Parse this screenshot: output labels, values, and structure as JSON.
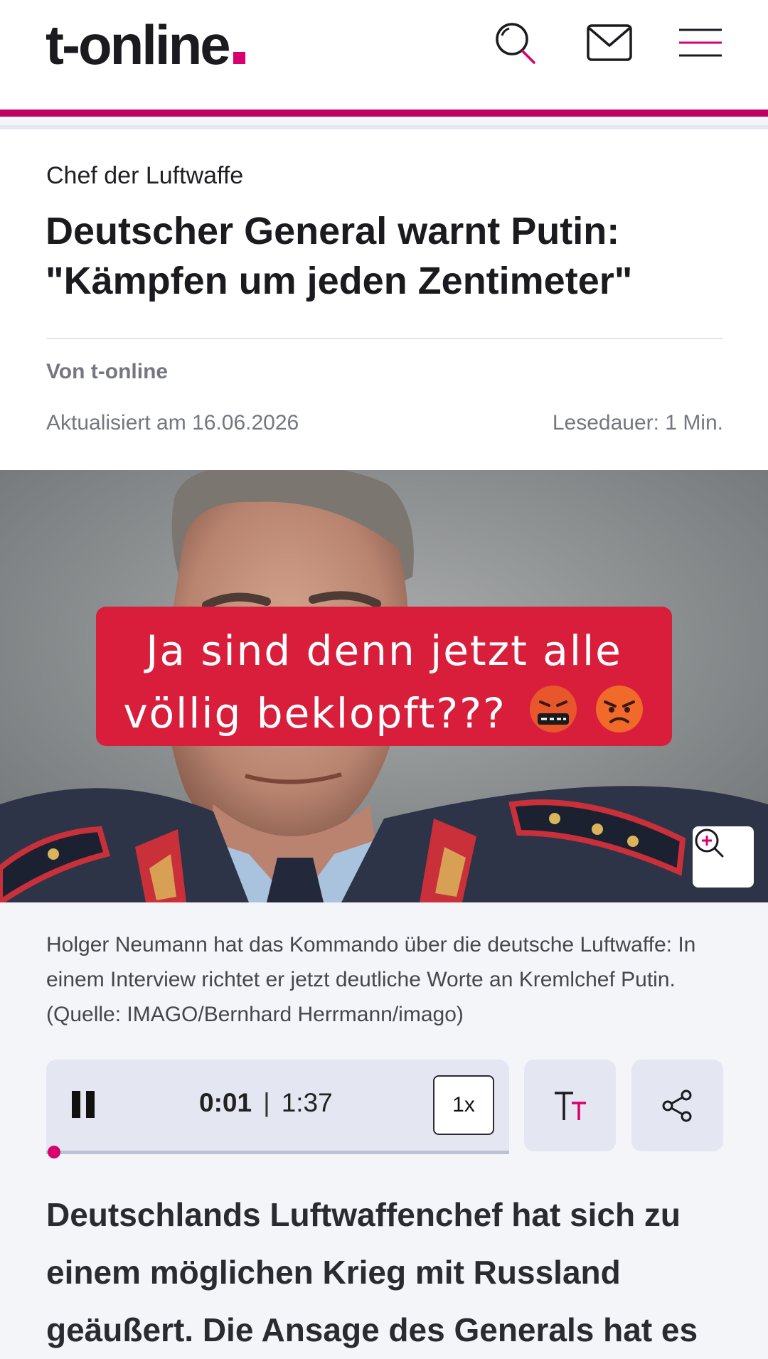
{
  "header": {
    "logo_text": "t-online",
    "logo_dot_color": "#d7006f",
    "icons": [
      "search-icon",
      "mail-icon",
      "menu-icon"
    ]
  },
  "article": {
    "kicker": "Chef der Luftwaffe",
    "title": "Deutscher General warnt Putin: \"Kämpfen um jeden Zentimeter\"",
    "author": "Von t-online",
    "updated": "Aktualisiert am 16.06.2026",
    "reading_time": "Lesedauer: 1 Min."
  },
  "image": {
    "overlay_line1": "Ja sind denn jetzt alle",
    "overlay_line2": "völlig beklopft???",
    "overlay_emoji": [
      "face-with-symbols-on-mouth",
      "angry-face"
    ],
    "overlay_color": "#d81e3a",
    "caption": "Holger Neumann hat das Kommando über die deutsche Luftwaffe: In einem Interview richtet er jetzt deutliche Worte an Kremlchef Putin. (Quelle: IMAGO/Bernhard Herrmann/imago)"
  },
  "player": {
    "current_time": "0:01",
    "separator": "|",
    "duration": "1:37",
    "speed": "1x",
    "progress_fraction": 0.01,
    "accent_color": "#d7006f"
  },
  "lead": "Deutschlands Luftwaffenchef hat sich zu einem möglichen Krieg mit Russland geäußert. Die Ansage des Generals hat es"
}
